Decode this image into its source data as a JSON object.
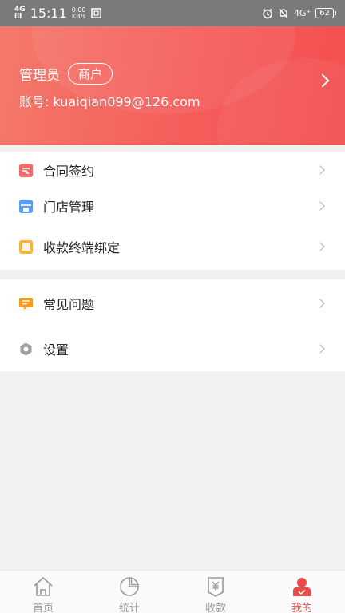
{
  "status_bar": {
    "network": "4G",
    "signal_label": "ill",
    "time": "15:11",
    "speed_value": "0.00",
    "speed_unit": "KB/s",
    "network_right": "4G⁺",
    "battery": "62"
  },
  "profile": {
    "role": "管理员",
    "badge": "商户",
    "account": "账号: kuaiqian099@126.com"
  },
  "menu_group_1": [
    {
      "label": "合同签约",
      "icon": "contract-icon",
      "color": "#f06b6b"
    },
    {
      "label": "门店管理",
      "icon": "store-icon",
      "color": "#5b9cf5"
    },
    {
      "label": "收款终端绑定",
      "icon": "terminal-icon",
      "color": "#f7b23b"
    }
  ],
  "menu_group_2": [
    {
      "label": "常见问题",
      "icon": "faq-icon",
      "color": "#f39c1f"
    },
    {
      "label": "设置",
      "icon": "settings-icon",
      "color": "#9aa0a6"
    }
  ],
  "tabs": [
    {
      "label": "首页",
      "icon": "home-icon",
      "active": false
    },
    {
      "label": "统计",
      "icon": "pie-chart-icon",
      "active": false
    },
    {
      "label": "收款",
      "icon": "yen-receipt-icon",
      "active": false
    },
    {
      "label": "我的",
      "icon": "profile-icon",
      "active": true
    }
  ],
  "colors": {
    "accent": "#e94a4a",
    "header_gradient_start": "#f47a6b",
    "header_gradient_end": "#f34f50"
  }
}
